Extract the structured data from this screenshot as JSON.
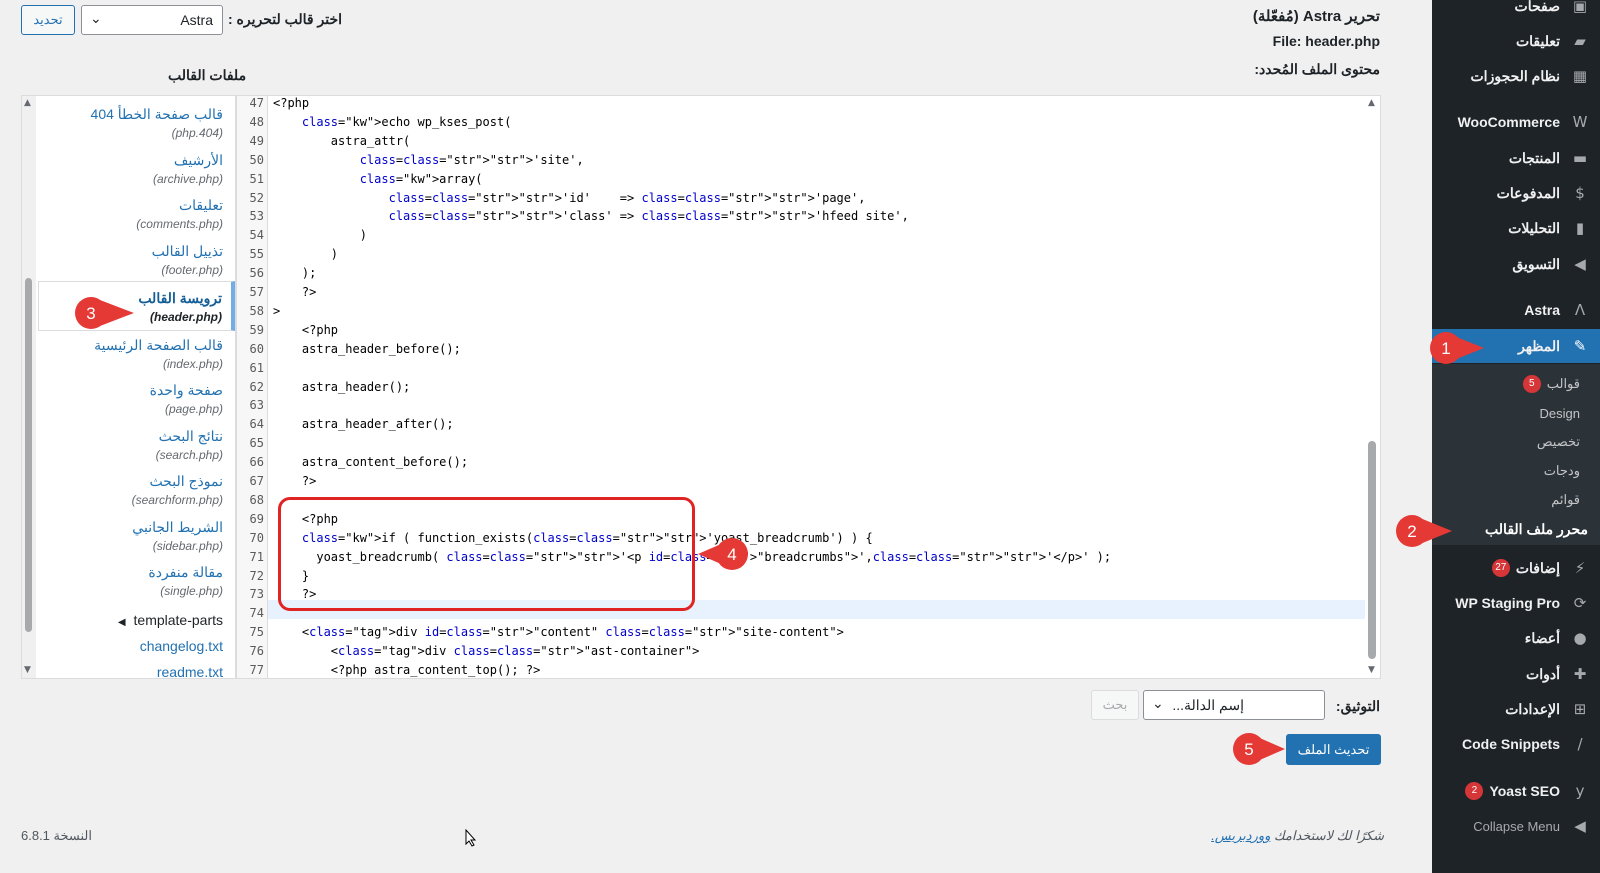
{
  "sidebar": {
    "items": [
      {
        "label": "صفحات",
        "icon": "pages-icon"
      },
      {
        "label": "تعليقات",
        "icon": "comments-icon"
      },
      {
        "label": "نظام الحجوزات",
        "icon": "calendar-icon"
      },
      {
        "label": "WooCommerce",
        "icon": "woocommerce-icon"
      },
      {
        "label": "المنتجات",
        "icon": "products-icon"
      },
      {
        "label": "المدفوعات",
        "icon": "payments-icon"
      },
      {
        "label": "التحليلات",
        "icon": "analytics-icon"
      },
      {
        "label": "التسويق",
        "icon": "marketing-icon"
      },
      {
        "label": "Astra",
        "icon": "astra-icon"
      },
      {
        "label": "المظهر",
        "icon": "appearance-icon"
      },
      {
        "label": "إضافات",
        "icon": "plugins-icon",
        "badge": "27"
      },
      {
        "label": "WP Staging Pro",
        "icon": "staging-icon"
      },
      {
        "label": "أعضاء",
        "icon": "users-icon"
      },
      {
        "label": "أدوات",
        "icon": "tools-icon"
      },
      {
        "label": "الإعدادات",
        "icon": "settings-icon"
      },
      {
        "label": "Code Snippets",
        "icon": "code-snippets-icon"
      },
      {
        "label": "Yoast SEO",
        "icon": "yoast-icon",
        "badge": "2"
      },
      {
        "label": "Collapse Menu",
        "icon": "collapse-icon"
      }
    ],
    "submenu": [
      {
        "label": "قوالب",
        "badge": "5"
      },
      {
        "label": "Design"
      },
      {
        "label": "تخصيص"
      },
      {
        "label": "ودجات"
      },
      {
        "label": "قوائم"
      },
      {
        "label": "محرر ملف القالب"
      }
    ],
    "active_color": "#2271b1"
  },
  "header": {
    "title": "تحرير Astra (مُفعّلة)",
    "file": "File: header.php",
    "content_label": "محتوى الملف المُحدد:",
    "choose_theme_label": "اختر قالب لتحريره :",
    "theme_select_value": "Astra",
    "update_theme_button": "تحديد",
    "theme_files_label": "ملفات القالب"
  },
  "files": [
    {
      "name": "قالب صفحة الخطأ 404",
      "file": "(404.php)"
    },
    {
      "name": "الأرشيف",
      "file": "(archive.php)"
    },
    {
      "name": "تعليقات",
      "file": "(comments.php)"
    },
    {
      "name": "تذييل القالب",
      "file": "(footer.php)"
    },
    {
      "name": "ترويسة القالب",
      "file": "(header.php)",
      "current": true
    },
    {
      "name": "قالب الصفحة الرئيسية",
      "file": "(index.php)"
    },
    {
      "name": "صفحة واحدة",
      "file": "(page.php)"
    },
    {
      "name": "نتائج البحث",
      "file": "(search.php)"
    },
    {
      "name": "نموذج البحث",
      "file": "(searchform.php)"
    },
    {
      "name": "الشريط الجانبي",
      "file": "(sidebar.php)"
    },
    {
      "name": "مقالة منفردة",
      "file": "(single.php)"
    }
  ],
  "extra_files": [
    "template-parts",
    "changelog.txt",
    "readme.txt"
  ],
  "code_lines": [
    {
      "n": "47",
      "text": "<?php"
    },
    {
      "n": "48",
      "text": "    echo wp_kses_post("
    },
    {
      "n": "49",
      "text": "        astra_attr("
    },
    {
      "n": "50",
      "text": "            'site',"
    },
    {
      "n": "51",
      "text": "            array("
    },
    {
      "n": "52",
      "text": "                'id'    => 'page',"
    },
    {
      "n": "53",
      "text": "                'class' => 'hfeed site',"
    },
    {
      "n": "54",
      "text": "            )"
    },
    {
      "n": "55",
      "text": "        )"
    },
    {
      "n": "56",
      "text": "    );"
    },
    {
      "n": "57",
      "text": "    ?>"
    },
    {
      "n": "58",
      "text": ">"
    },
    {
      "n": "59",
      "text": "    <?php"
    },
    {
      "n": "60",
      "text": "    astra_header_before();"
    },
    {
      "n": "61",
      "text": ""
    },
    {
      "n": "62",
      "text": "    astra_header();"
    },
    {
      "n": "63",
      "text": ""
    },
    {
      "n": "64",
      "text": "    astra_header_after();"
    },
    {
      "n": "65",
      "text": ""
    },
    {
      "n": "66",
      "text": "    astra_content_before();"
    },
    {
      "n": "67",
      "text": "    ?>"
    },
    {
      "n": "68",
      "text": ""
    },
    {
      "n": "69",
      "text": "    <?php"
    },
    {
      "n": "70",
      "text": "    if ( function_exists('yoast_breadcrumb') ) {"
    },
    {
      "n": "71",
      "text": "      yoast_breadcrumb( '<p id=\"breadcrumbs\">','</p>' );"
    },
    {
      "n": "72",
      "text": "    }"
    },
    {
      "n": "73",
      "text": "    ?>"
    },
    {
      "n": "74",
      "text": ""
    },
    {
      "n": "75",
      "text": "    <div id=\"content\" class=\"site-content\">"
    },
    {
      "n": "76",
      "text": "        <div class=\"ast-container\">"
    },
    {
      "n": "77",
      "text": "        <?php astra_content_top(); ?>"
    }
  ],
  "bottom": {
    "doc_label": "التوثيق:",
    "func_placeholder": "إسم الدالة...",
    "lookup_button": "بحث",
    "update_file_button": "تحديث الملف"
  },
  "footer": {
    "thanks_prefix": "شكرًا لك لاستخدامك ",
    "thanks_link": "ووردبريس.",
    "version": "النسخة 6.8.1"
  },
  "markers": [
    "1",
    "2",
    "3",
    "4",
    "5"
  ],
  "marker_color": "#e53935"
}
